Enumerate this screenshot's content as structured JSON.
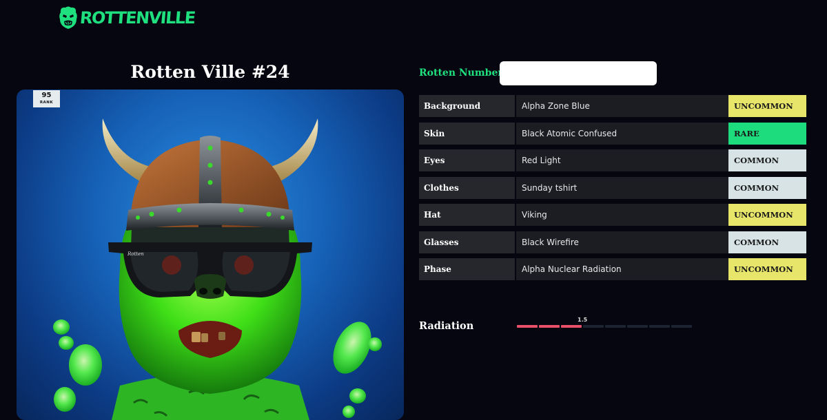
{
  "header": {
    "logo_text": "ROTTENVILLE"
  },
  "nft": {
    "title": "Rotten Ville #24",
    "rank_number": "95",
    "rank_label": "RANK",
    "glasses_brand": "Rotten"
  },
  "search": {
    "label": "Rotten Number",
    "value": "",
    "placeholder": ""
  },
  "traits": [
    {
      "name": "Background",
      "value": "Alpha Zone Blue",
      "rarity": "UNCOMMON"
    },
    {
      "name": "Skin",
      "value": "Black Atomic Confused",
      "rarity": "RARE"
    },
    {
      "name": "Eyes",
      "value": "Red Light",
      "rarity": "COMMON"
    },
    {
      "name": "Clothes",
      "value": "Sunday tshirt",
      "rarity": "COMMON"
    },
    {
      "name": "Hat",
      "value": "Viking",
      "rarity": "UNCOMMON"
    },
    {
      "name": "Glasses",
      "value": "Black Wirefire",
      "rarity": "COMMON"
    },
    {
      "name": "Phase",
      "value": "Alpha Nuclear Radiation",
      "rarity": "UNCOMMON"
    }
  ],
  "radiation": {
    "label": "Radiation",
    "value": "1.5",
    "segments_total": 8,
    "segments_filled": 3
  },
  "colors": {
    "accent": "#1fe07e",
    "uncommon": "#e8e66a",
    "rare": "#1ddc7e",
    "common": "#d8e3e6",
    "radiation_fill": "#e8506a",
    "background": "#060611"
  },
  "icons": {
    "logo": "gorilla-logo-icon"
  }
}
